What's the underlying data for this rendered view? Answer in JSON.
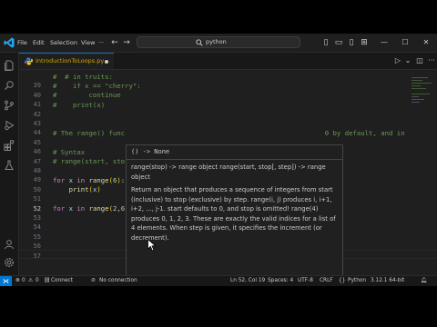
{
  "menu": [
    "File",
    "Edit",
    "Selection",
    "View"
  ],
  "search": {
    "text": "python"
  },
  "tab": {
    "filename": "IntroductionToLoops.py"
  },
  "editor": {
    "lines": [
      {
        "n": "",
        "html": "<span class=\"c-com\">#  # in truits:</span>"
      },
      {
        "n": "39",
        "html": "<span class=\"c-com\">#    if x == \"cherry\":</span>"
      },
      {
        "n": "40",
        "html": "<span class=\"c-com\">#        continue</span>"
      },
      {
        "n": "41",
        "html": "<span class=\"c-com\">#    print(x)</span>"
      },
      {
        "n": "42",
        "html": ""
      },
      {
        "n": "43",
        "html": ""
      },
      {
        "n": "44",
        "html": "<span class=\"c-com\"># The range() func                                                  0 by default, and in</span>"
      },
      {
        "n": "45",
        "html": ""
      },
      {
        "n": "46",
        "html": "<span class=\"c-com\"># Syntax</span>"
      },
      {
        "n": "47",
        "html": "<span class=\"c-com\"># range(start, sto</span>"
      },
      {
        "n": "48",
        "html": ""
      },
      {
        "n": "49",
        "html": "<span class=\"c-kw\">for</span> <span class=\"c-var\">x</span> <span class=\"c-kw\">in</span> <span class=\"c-fn\">range</span><span class=\"c-br1\">(</span><span class=\"c-num\">6</span><span class=\"c-br1\">)</span>:"
      },
      {
        "n": "50",
        "html": "    <span class=\"c-fn\">print</span><span class=\"c-br1\">(</span><span class=\"c-var\">x</span><span class=\"c-br1\">)</span>"
      },
      {
        "n": "51",
        "html": ""
      },
      {
        "n": "52",
        "html": "<span class=\"c-kw\">for</span> <span class=\"c-var\">x</span> <span class=\"c-kw\">in</span> <span class=\"c-fn\">range</span><span class=\"c-br1\">(</span><span class=\"c-num\">2</span>,<span class=\"c-num\">6</span><span class=\"c-br1\">)</span>"
      },
      {
        "n": "53",
        "html": ""
      },
      {
        "n": "54",
        "html": ""
      },
      {
        "n": "55",
        "html": ""
      },
      {
        "n": "56",
        "html": ""
      },
      {
        "n": "57",
        "html": ""
      }
    ],
    "current_line": "52"
  },
  "hover": {
    "signature": "() -> None",
    "overload": "range(stop) -> range object range(start, stop[, step]) -> range object",
    "doc": "Return an object that produces a sequence of integers from start (inclusive) to stop (exclusive) by step. range(i, j) produces i, i+1, i+2, ..., j-1. start defaults to 0, and stop is omitted! range(4) produces 0, 1, 2, 3. These are exactly the valid indices for a list of 4 elements. When step is given, it specifies the increment (or decrement)."
  },
  "status": {
    "errors": "0",
    "warnings": "0",
    "connect": "Connect",
    "no_connection": "No connection",
    "position": "Ln 52, Col 19",
    "spaces": "Spaces: 4",
    "encoding": "UTF-8",
    "eol": "CRLF",
    "language": "Python",
    "interpreter": "3.12.1 64-bit"
  }
}
